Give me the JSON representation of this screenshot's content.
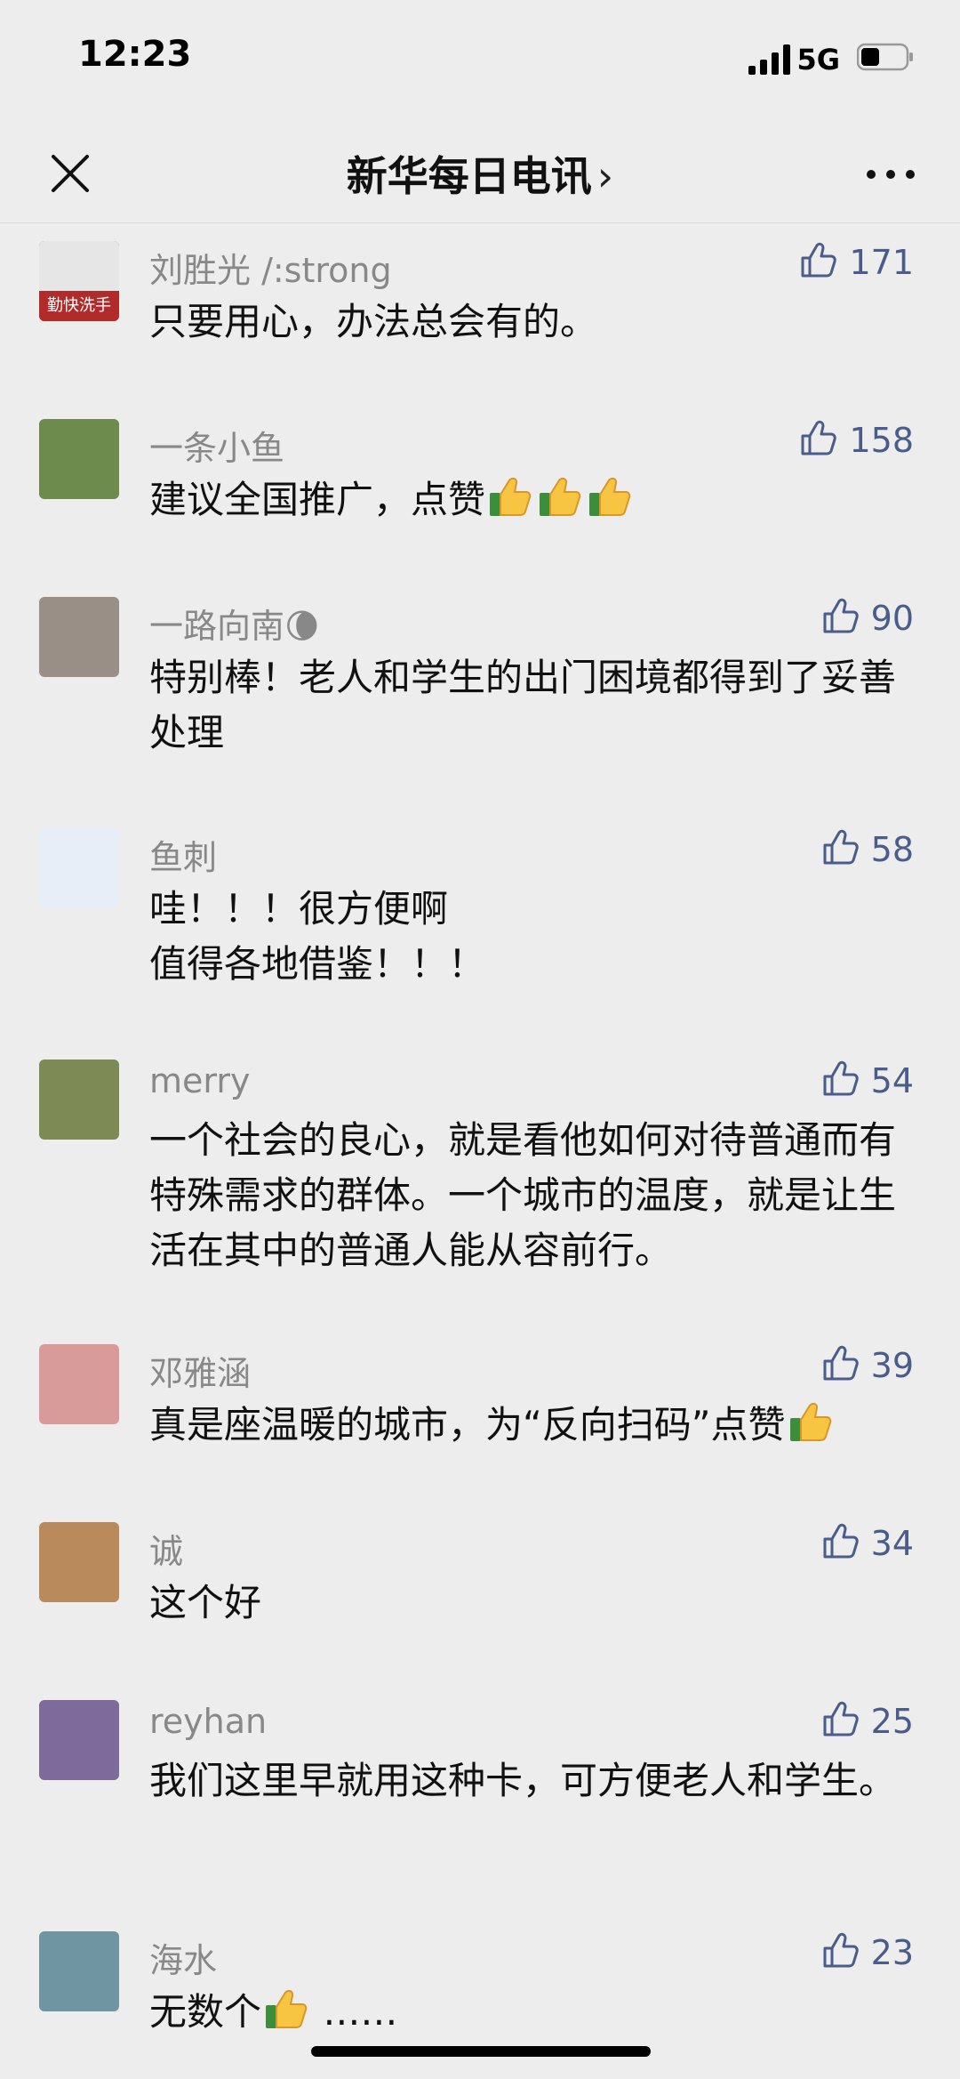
{
  "status_bar": {
    "time": "12:23",
    "network": "5G"
  },
  "nav": {
    "title": "新华每日电讯",
    "title_chevron": "›",
    "close_icon": "close-icon",
    "more_icon": "more-dots-icon"
  },
  "colors": {
    "background": "#ededed",
    "nickname": "#888888",
    "like": "#4a5d8a"
  },
  "comments": [
    {
      "nickname": "刘胜光 /:strong",
      "likes": "171",
      "text": "只要用心，办法总会有的。",
      "avatar_color": "#b22b2b",
      "avatar_label": "勤快洗手"
    },
    {
      "nickname": "一条小鱼",
      "likes": "158",
      "text": "建议全国推广，点赞",
      "emojis": 3,
      "avatar_color": "#6e8b4e"
    },
    {
      "nickname": "一路向南🌘",
      "likes": "90",
      "text": "特别棒！老人和学生的出门困境都得到了妥善处理",
      "avatar_color": "#9a8f86"
    },
    {
      "nickname": "鱼刺",
      "likes": "58",
      "text": "哇！！！很方便啊\n值得各地借鉴！！！",
      "avatar_color": "#e8eef7"
    },
    {
      "nickname": "merry",
      "likes": "54",
      "text": "一个社会的良心，就是看他如何对待普通而有特殊需求的群体。一个城市的温度，就是让生活在其中的普通人能从容前行。",
      "avatar_color": "#7d8a55"
    },
    {
      "nickname": "邓雅涵",
      "likes": "39",
      "text": "真是座温暖的城市，为“反向扫码”点赞",
      "emojis": 1,
      "avatar_color": "#d99a9a"
    },
    {
      "nickname": "诚",
      "likes": "34",
      "text": "这个好",
      "avatar_color": "#b98b5c"
    },
    {
      "nickname": "reyhan",
      "likes": "25",
      "text": "我们这里早就用这种卡，可方便老人和学生。",
      "avatar_color": "#7f6a9c"
    },
    {
      "nickname": "海水",
      "likes": "23",
      "text": "无数个",
      "emojis": 1,
      "text_suffix": " ……",
      "avatar_color": "#6f95a3"
    }
  ]
}
